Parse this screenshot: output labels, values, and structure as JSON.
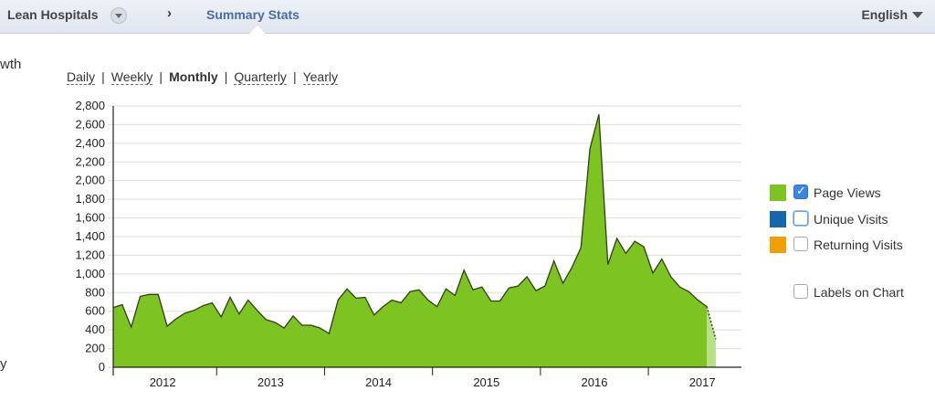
{
  "header": {
    "breadcrumb_root": "Lean Hospitals",
    "breadcrumb_separator": "›",
    "breadcrumb_active": "Summary Stats",
    "language": "English"
  },
  "side_text": {
    "top": "wth",
    "bottom": "y"
  },
  "periods": [
    {
      "label": "Daily",
      "active": false
    },
    {
      "label": "Weekly",
      "active": false
    },
    {
      "label": "Monthly",
      "active": true
    },
    {
      "label": "Quarterly",
      "active": false
    },
    {
      "label": "Yearly",
      "active": false
    }
  ],
  "legend": [
    {
      "label": "Page Views",
      "color": "#7dc422",
      "checked": true
    },
    {
      "label": "Unique Visits",
      "color": "#1565b0",
      "checked": false
    },
    {
      "label": "Returning Visits",
      "color": "#f0a000",
      "checked": false
    }
  ],
  "labels_on_chart": {
    "label": "Labels on Chart",
    "checked": false
  },
  "colors": {
    "area_fill": "#7dc422",
    "partial_fill": "#b8e08a",
    "line": "#2f3f16",
    "grid": "#dddddd"
  },
  "chart_data": {
    "type": "area",
    "series": [
      {
        "name": "Page Views",
        "x_start": "2012-01",
        "values": [
          640,
          670,
          430,
          760,
          780,
          780,
          440,
          520,
          580,
          610,
          660,
          690,
          540,
          750,
          570,
          720,
          610,
          510,
          480,
          420,
          550,
          450,
          450,
          420,
          360,
          720,
          840,
          740,
          750,
          560,
          650,
          720,
          690,
          810,
          830,
          720,
          650,
          840,
          770,
          1040,
          830,
          860,
          710,
          710,
          850,
          870,
          970,
          820,
          870,
          1140,
          900,
          1070,
          1280,
          2340,
          2710,
          1100,
          1380,
          1220,
          1350,
          1290,
          1010,
          1160,
          970,
          860,
          810,
          720,
          650,
          300
        ]
      }
    ],
    "x_tick_labels": [
      "2012",
      "2013",
      "2014",
      "2015",
      "2016",
      "2017"
    ],
    "y_ticks": [
      0,
      200,
      400,
      600,
      800,
      1000,
      1200,
      1400,
      1600,
      1800,
      2000,
      2200,
      2400,
      2600,
      2800
    ],
    "ylim": [
      0,
      2800
    ],
    "grid": true,
    "last_point_partial": true,
    "legend_position": "right"
  }
}
